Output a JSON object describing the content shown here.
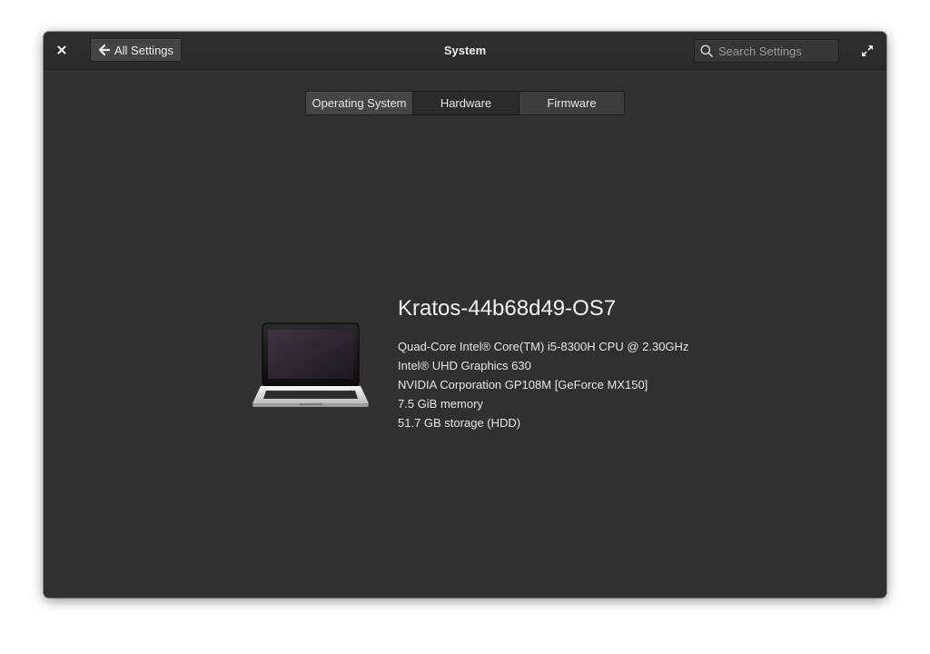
{
  "window": {
    "title": "System"
  },
  "header": {
    "back_label": "All Settings",
    "search_placeholder": "Search Settings"
  },
  "tabs": [
    {
      "label": "Operating System",
      "active": true
    },
    {
      "label": "Hardware",
      "active": false
    },
    {
      "label": "Firmware",
      "active": false
    }
  ],
  "device": {
    "icon": "laptop-icon",
    "hostname": "Kratos-44b68d49-OS7",
    "specs": [
      "Quad-Core Intel® Core(TM) i5-8300H CPU @ 2.30GHz",
      "Intel® UHD Graphics 630",
      "NVIDIA Corporation GP108M [GeForce MX150]",
      "7.5 GiB memory",
      "51.7 GB storage (HDD)"
    ]
  },
  "icons": {
    "close": "close-icon",
    "back": "arrow-left-icon",
    "search": "search-icon",
    "maximize": "maximize-icon"
  },
  "colors": {
    "window_bg": "#303030",
    "titlebar_bg": "#2c2c2c",
    "text": "#eeeeee",
    "button_bg": "#444444"
  }
}
